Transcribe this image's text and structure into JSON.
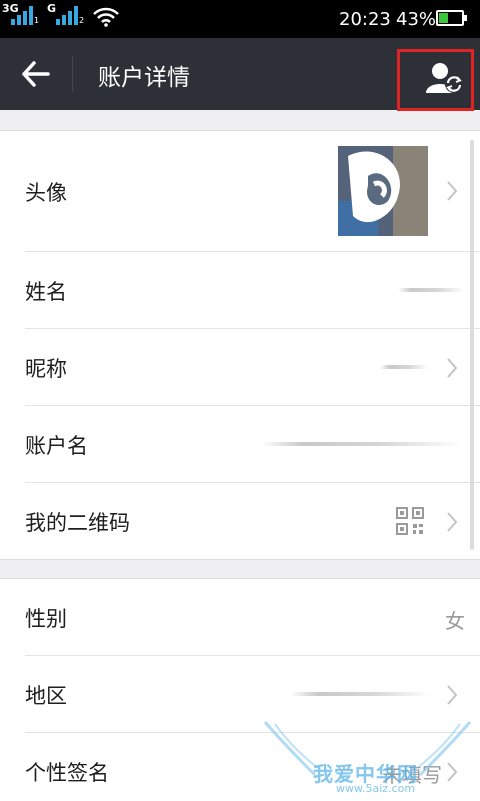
{
  "status_bar": {
    "network_1": "3G",
    "network_2": "G",
    "time": "20:23",
    "battery_percent": "43%",
    "battery_level": 0.43
  },
  "header": {
    "title": "账户详情",
    "back_icon": "back-arrow-icon",
    "action_icon": "user-sync-icon"
  },
  "section1": [
    {
      "label": "头像",
      "type": "avatar"
    },
    {
      "label": "姓名",
      "type": "text"
    },
    {
      "label": "昵称",
      "type": "text"
    },
    {
      "label": "账户名",
      "type": "text"
    },
    {
      "label": "我的二维码",
      "type": "qr"
    }
  ],
  "section2": [
    {
      "label": "性别",
      "value": "女"
    },
    {
      "label": "地区",
      "value": ""
    },
    {
      "label": "个性签名",
      "value": "未填写"
    }
  ],
  "colors": {
    "header_bg": "#2e3037",
    "highlight_box": "#e02424",
    "page_bg": "#efeff2"
  },
  "watermark": {
    "text": "我爱中华网",
    "url": "www.5aiz.com"
  }
}
